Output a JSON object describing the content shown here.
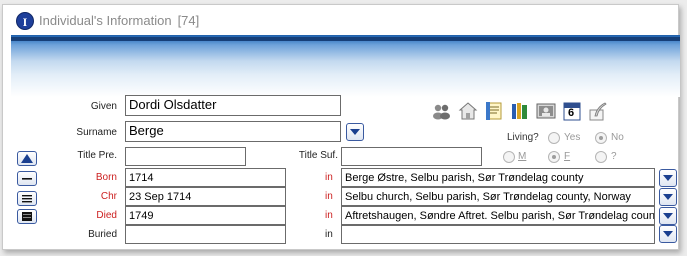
{
  "window": {
    "app_icon_letter": "I",
    "title": "Individual's Information",
    "record_id": "[74]"
  },
  "colors": {
    "banner_dark": "#163f78",
    "banner_light": "#c3d9ef",
    "event_label_red": "#cc1f1f",
    "button_border": "#3a5aa0"
  },
  "toolbar_icons": [
    "people-group-icon",
    "house-icon",
    "notes-icon",
    "books-icon",
    "photo-icon",
    "calendar-icon",
    "quill-icon"
  ],
  "calendar_day": "6",
  "name": {
    "given_label": "Given",
    "given_value": "Dordi Olsdatter",
    "surname_label": "Surname",
    "surname_value": "Berge",
    "title_pre_label": "Title Pre.",
    "title_pre_value": "",
    "title_suf_label": "Title Suf.",
    "title_suf_value": ""
  },
  "living": {
    "label": "Living?",
    "yes": "Yes",
    "no": "No",
    "selected": "No"
  },
  "sex": {
    "m": "M",
    "f": "F",
    "unknown": "?",
    "selected": "F"
  },
  "events": [
    {
      "label": "Born",
      "date": "1714",
      "in_label": "in",
      "place": "Berge Østre, Selbu parish, Sør Trøndelag county"
    },
    {
      "label": "Chr",
      "date": "23 Sep 1714",
      "in_label": "in",
      "place": "Selbu church, Selbu parish, Sør Trøndelag county, Norway"
    },
    {
      "label": "Died",
      "date": "1749",
      "in_label": "in",
      "place": "Aftretshaugen, Søndre Aftret. Selbu parish, Sør Trøndelag county"
    },
    {
      "label": "Buried",
      "date": "",
      "in_label": "in",
      "place": ""
    }
  ],
  "nav_buttons": [
    "move-up",
    "collapse",
    "expand",
    "all"
  ]
}
